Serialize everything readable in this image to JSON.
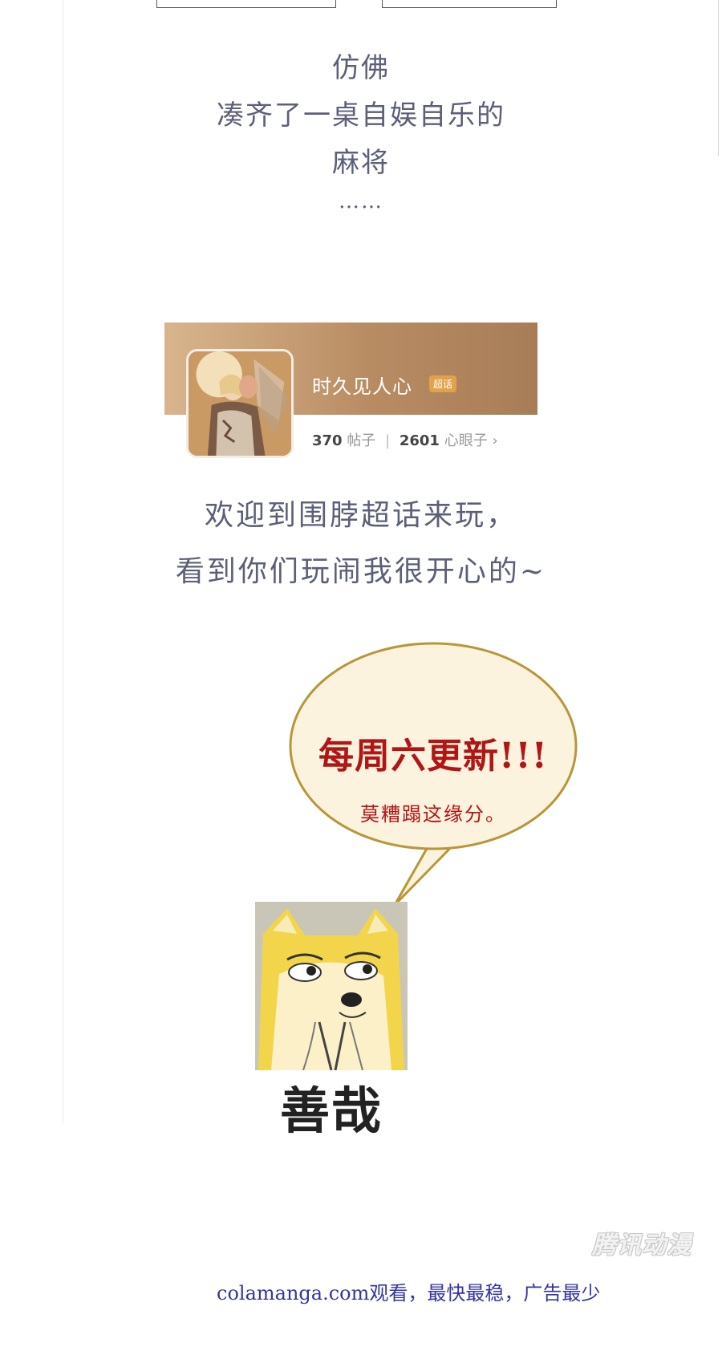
{
  "poem": {
    "line1": "仿佛",
    "line2": "凑齐了一桌自娱自乐的",
    "line3": "麻将",
    "line4": "……"
  },
  "card": {
    "name": "时久见人心",
    "tag": "超话",
    "posts_count": "370",
    "posts_label": "帖子",
    "fans_count": "2601",
    "fans_label": "心眼子",
    "chevron": "›"
  },
  "welcome": {
    "line1": "欢迎到围脖超话来玩，",
    "line2": "看到你们玩闹我很开心的~"
  },
  "bubble": {
    "main": "每周六更新!!!",
    "sub": "莫糟蹋这缘分。"
  },
  "meme": {
    "caption": "善哉"
  },
  "watermark": "腾讯动漫",
  "footer": "colamanga.com观看，最快最稳，广告最少",
  "colors": {
    "text_slate": "#5b5f78",
    "bubble_red": "#b21515",
    "bubble_fill": "#fbf3dd",
    "bubble_border": "#b8963a",
    "footer_blue": "#3535a0"
  }
}
